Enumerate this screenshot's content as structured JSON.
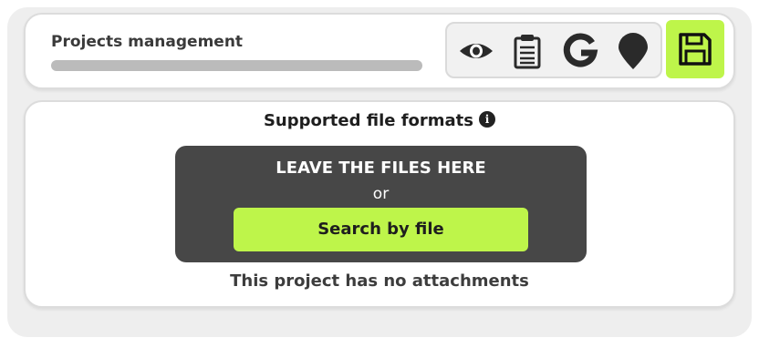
{
  "header": {
    "title": "Projects management",
    "progress_percent": 100
  },
  "toolbar": {
    "icons": [
      "eye-icon",
      "clipboard-icon",
      "google-icon",
      "map-pin-icon"
    ],
    "save_icon": "floppy-disk-icon",
    "save_color": "#bef54a"
  },
  "upload": {
    "formats_label": "Supported file formats",
    "info_glyph": "i",
    "dropzone_title": "LEAVE THE FILES HERE",
    "or_label": "or",
    "search_button_label": "Search by file",
    "empty_message": "This project has no attachments"
  },
  "colors": {
    "accent": "#bef54a",
    "dropzone_bg": "#474747",
    "text": "#1e1e1e"
  }
}
